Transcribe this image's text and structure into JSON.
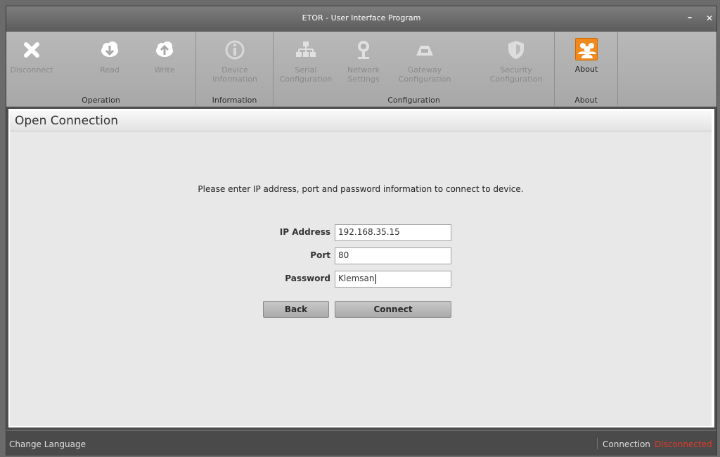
{
  "window": {
    "title": "ETOR - User Interface Program",
    "min_glyph": "–",
    "close_glyph": "✕"
  },
  "ribbon": {
    "groups": [
      {
        "label": "Operation",
        "buttons": [
          {
            "label": "Disconnect",
            "icon": "close-icon"
          },
          {
            "label": "Read",
            "icon": "cloud-download-icon"
          },
          {
            "label": "Write",
            "icon": "cloud-upload-icon"
          }
        ]
      },
      {
        "label": "Information",
        "buttons": [
          {
            "label": "Device Information",
            "icon": "info-icon"
          }
        ]
      },
      {
        "label": "Configuration",
        "buttons": [
          {
            "label": "Serial Configuration",
            "icon": "hierarchy-icon"
          },
          {
            "label": "Network Settings",
            "icon": "network-icon"
          },
          {
            "label": "Gateway Configuration",
            "icon": "gateway-icon"
          },
          {
            "label": "Security Configuration",
            "icon": "shield-icon"
          }
        ]
      },
      {
        "label": "About",
        "buttons": [
          {
            "label": "About",
            "icon": "users-icon"
          }
        ]
      }
    ]
  },
  "panel": {
    "title": "Open Connection",
    "instruction": "Please enter IP address, port and password information to connect to device.",
    "fields": {
      "ip_label": "IP Address",
      "ip_value": "192.168.35.15",
      "port_label": "Port",
      "port_value": "80",
      "password_label": "Password",
      "password_value": "Klemsan"
    },
    "back_label": "Back",
    "connect_label": "Connect"
  },
  "statusbar": {
    "language_label": "Change Language",
    "connection_label": "Connection",
    "connection_state": "Disconnected",
    "state_color": "#e23a2a"
  },
  "colors": {
    "accent_about": "#f08a1c"
  }
}
